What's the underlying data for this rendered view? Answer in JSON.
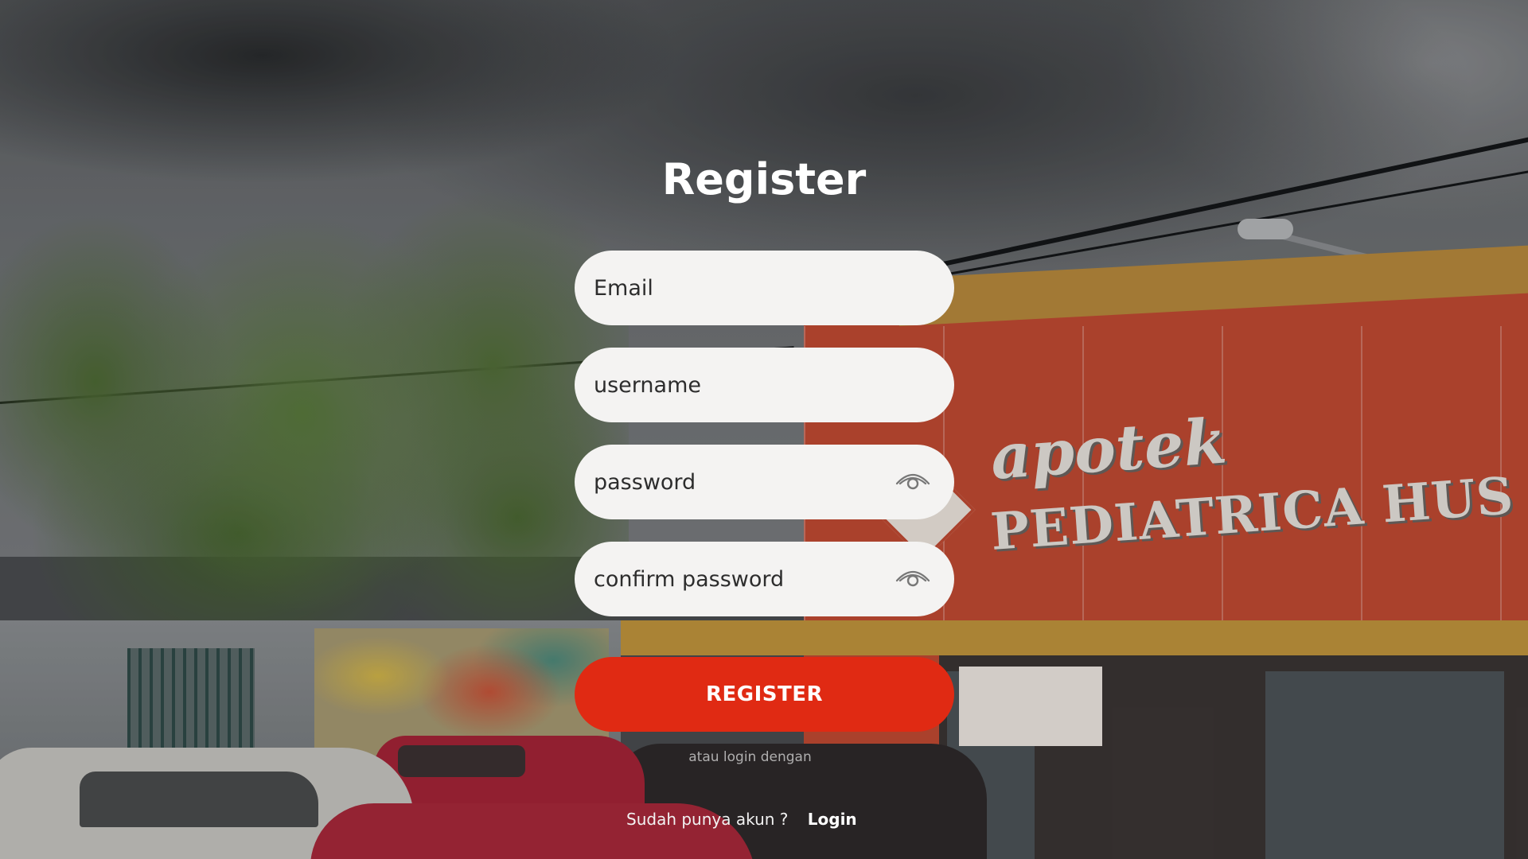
{
  "form": {
    "title": "Register",
    "email_placeholder": "Email",
    "username_placeholder": "username",
    "password_placeholder": "password",
    "confirm_password_placeholder": "confirm password",
    "register_button_label": "REGISTER",
    "alt_login_text": "atau login dengan",
    "have_account_text": "Sudah punya akun ?",
    "login_link_label": "Login"
  },
  "background": {
    "sign_line1": "apotek",
    "sign_line2": "PEDIATRICA HUS"
  },
  "colors": {
    "register_button": "#e02a13",
    "field_background": "#f4f3f2",
    "title_text": "#ffffff"
  },
  "icons": {
    "password_toggle": "eye-icon",
    "confirm_password_toggle": "eye-icon"
  }
}
